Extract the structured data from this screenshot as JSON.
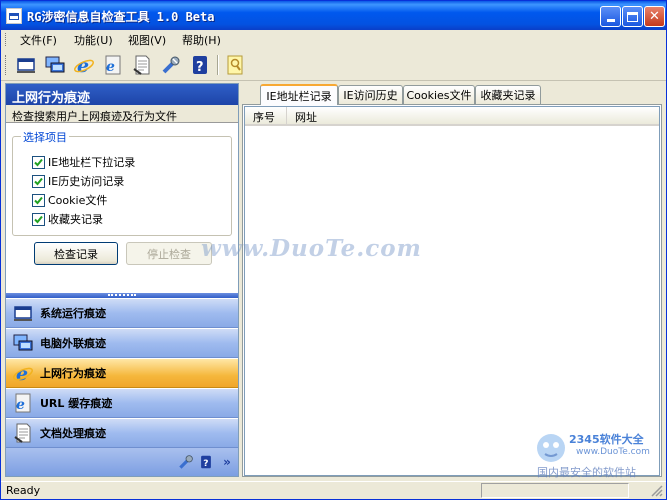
{
  "window": {
    "title": "RG涉密信息自检查工具 1.0 Beta",
    "colors": {
      "titlebar": "#0058ee",
      "accent_tab": "#f7a833",
      "active_nav": "#f5b73c"
    }
  },
  "menu": {
    "items": [
      "文件(F)",
      "功能(U)",
      "视图(V)",
      "帮助(H)"
    ]
  },
  "toolbar": {
    "icons": [
      "system-run-icon",
      "computer-network-icon",
      "ie-browser-icon",
      "url-cache-icon",
      "document-icon",
      "tools-icon",
      "help-icon",
      "note-icon"
    ]
  },
  "left": {
    "section_title": "上网行为痕迹",
    "section_desc": "检查搜索用户上网痕迹及行为文件",
    "group_title": "选择项目",
    "checks": [
      {
        "label": "IE地址栏下拉记录",
        "checked": true
      },
      {
        "label": "IE历史访问记录",
        "checked": true
      },
      {
        "label": "Cookie文件",
        "checked": true
      },
      {
        "label": "收藏夹记录",
        "checked": true
      }
    ],
    "check_button": "检查记录",
    "stop_button": "停止检查",
    "nav": [
      {
        "label": "系统运行痕迹",
        "icon": "system-run-icon",
        "active": false
      },
      {
        "label": "电脑外联痕迹",
        "icon": "computer-network-icon",
        "active": false
      },
      {
        "label": "上网行为痕迹",
        "icon": "ie-browser-icon",
        "active": true
      },
      {
        "label": "URL 缓存痕迹",
        "icon": "url-cache-icon",
        "active": false
      },
      {
        "label": "文档处理痕迹",
        "icon": "document-icon",
        "active": false
      }
    ]
  },
  "right": {
    "tabs": [
      "IE地址栏记录",
      "IE访问历史",
      "Cookies文件",
      "收藏夹记录"
    ],
    "active_tab": 0,
    "columns": [
      "序号",
      "网址"
    ]
  },
  "watermark": {
    "text": "www.DuoTe.com",
    "brand": "2345软件大全",
    "url": "www.DuoTe.com",
    "slogan": "国内最安全的软件站"
  },
  "status": {
    "text": "Ready"
  }
}
